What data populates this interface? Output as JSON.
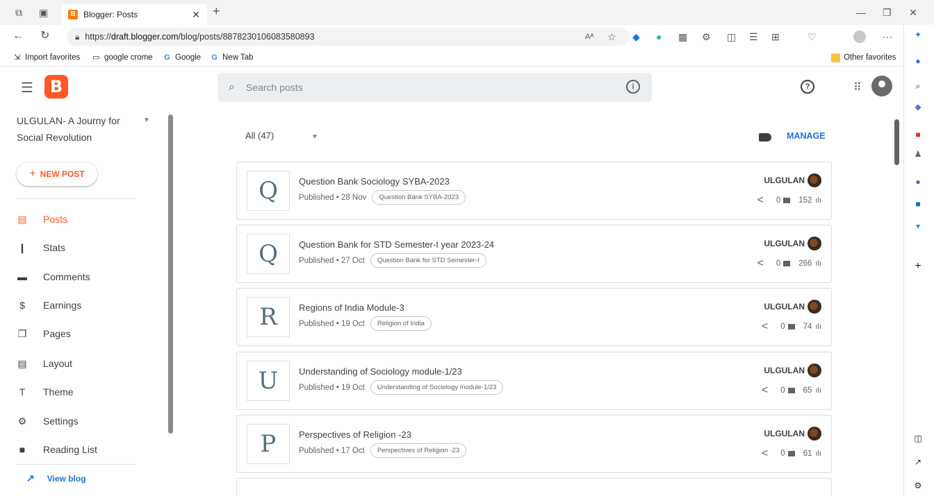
{
  "browser": {
    "tab_title": "Blogger: Posts",
    "tab_favicon": "B",
    "url_prefix": "https://",
    "url_host": "draft.blogger.com",
    "url_path": "/blog/posts/8878230106083580893",
    "favorites": [
      {
        "label": "Import favorites",
        "icon": "import-icon"
      },
      {
        "label": "google crome",
        "icon": "folder-icon"
      },
      {
        "label": "Google",
        "icon": "google-icon"
      },
      {
        "label": "New Tab",
        "icon": "google-icon"
      }
    ],
    "other_favorites": "Other favorites",
    "read_aloud_icon": "Aᴬ"
  },
  "app": {
    "logo_letter": "B",
    "search_placeholder": "Search posts",
    "brand_color": "#ff5722"
  },
  "sidebar": {
    "blog_title": "ULGULAN- A Journy for Social Revolution",
    "new_post_label": "NEW POST",
    "items": [
      {
        "label": "Posts",
        "icon": "posts-icon",
        "glyph": "▤",
        "active": true
      },
      {
        "label": "Stats",
        "icon": "stats-icon",
        "glyph": "❙",
        "active": false
      },
      {
        "label": "Comments",
        "icon": "comments-icon",
        "glyph": "▬",
        "active": false
      },
      {
        "label": "Earnings",
        "icon": "earnings-icon",
        "glyph": "$",
        "active": false
      },
      {
        "label": "Pages",
        "icon": "pages-icon",
        "glyph": "❐",
        "active": false
      },
      {
        "label": "Layout",
        "icon": "layout-icon",
        "glyph": "▤",
        "active": false
      },
      {
        "label": "Theme",
        "icon": "theme-icon",
        "glyph": "Τ",
        "active": false
      },
      {
        "label": "Settings",
        "icon": "settings-icon",
        "glyph": "⚙",
        "active": false
      },
      {
        "label": "Reading List",
        "icon": "bookmark-icon",
        "glyph": "■",
        "active": false
      }
    ],
    "view_blog_label": "View blog"
  },
  "toolbar": {
    "filter_label": "All (47)",
    "manage_label": "MANAGE"
  },
  "posts": [
    {
      "letter": "Q",
      "title": "Question Bank Sociology SYBA-2023",
      "status": "Published",
      "date": "28 Nov",
      "label": "Question Bank SYBA-2023",
      "author": "ULGULAN",
      "comments": "0",
      "views": "152"
    },
    {
      "letter": "Q",
      "title": "Question Bank for STD Semester-I year 2023-24",
      "status": "Published",
      "date": "27 Oct",
      "label": "Question Bank for STD Semester-I",
      "author": "ULGULAN",
      "comments": "0",
      "views": "266"
    },
    {
      "letter": "R",
      "title": "Regions of India Module-3",
      "status": "Published",
      "date": "19 Oct",
      "label": "Religion of India",
      "author": "ULGULAN",
      "comments": "0",
      "views": "74"
    },
    {
      "letter": "U",
      "title": "Understanding of Sociology module-1/23",
      "status": "Published",
      "date": "19 Oct",
      "label": "Understanding of Sociology module-1/23",
      "author": "ULGULAN",
      "comments": "0",
      "views": "65"
    },
    {
      "letter": "P",
      "title": "Perspectives of Religion -23",
      "status": "Published",
      "date": "17 Oct",
      "label": "Perspectives of Religion -23",
      "author": "ULGULAN",
      "comments": "0",
      "views": "61"
    }
  ]
}
